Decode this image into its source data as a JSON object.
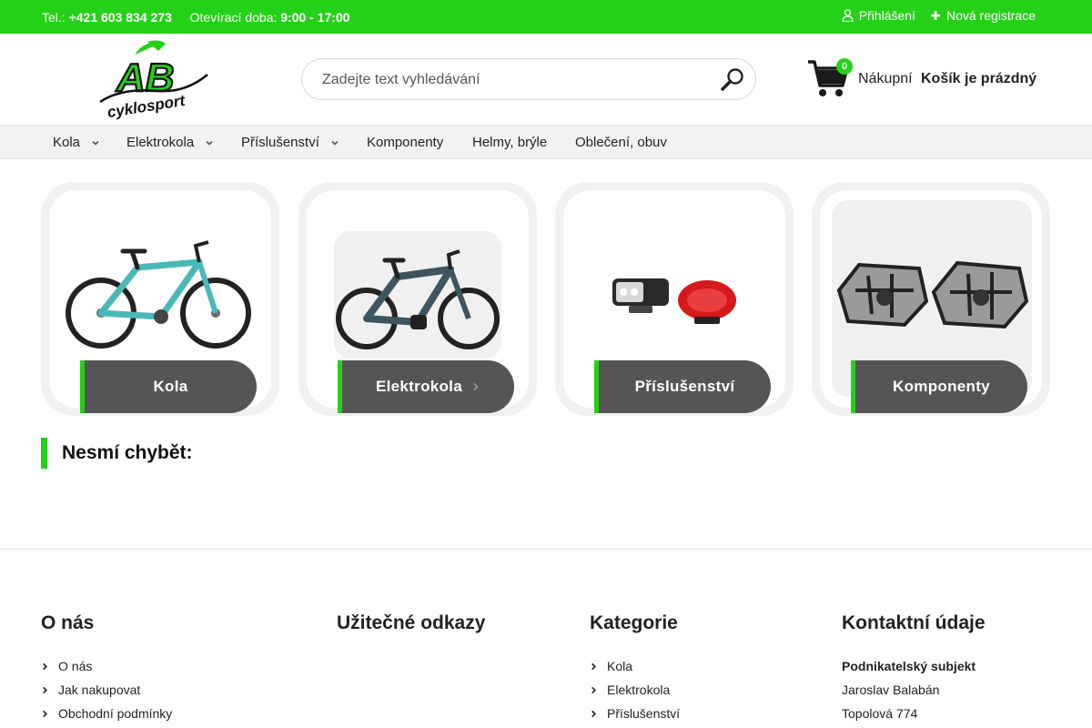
{
  "topbar": {
    "phone_label": "Tel.:",
    "phone": "+421 603 834 273",
    "hours_label": "Otevírací doba:",
    "hours": "9:00 - 17:00",
    "login": "Přihlášení",
    "register": "Nová registrace"
  },
  "logo": {
    "text_main": "AB",
    "text_sub": "cyklosport"
  },
  "search": {
    "placeholder": "Zadejte text vyhledávání"
  },
  "cart": {
    "count": "0",
    "label": "Nákupní",
    "status": "Košík je prázdný"
  },
  "nav": {
    "items": [
      {
        "label": "Kola"
      },
      {
        "label": "Elektrokola"
      },
      {
        "label": "Příslušenství"
      },
      {
        "label": "Komponenty"
      },
      {
        "label": "Helmy, brýle"
      },
      {
        "label": "Oblečení, obuv"
      }
    ]
  },
  "categories": [
    {
      "label": "Kola"
    },
    {
      "label": "Elektrokola"
    },
    {
      "label": "Příslušenství"
    },
    {
      "label": "Komponenty"
    }
  ],
  "section": {
    "title": "Nesmí chybět:"
  },
  "footer": {
    "about": {
      "title": "O nás",
      "links": [
        "O nás",
        "Jak nakupovat",
        "Obchodní podmínky"
      ]
    },
    "useful": {
      "title": "Užitečné odkazy"
    },
    "categories": {
      "title": "Kategorie",
      "links": [
        "Kola",
        "Elektrokola",
        "Příslušenství"
      ]
    },
    "contact": {
      "title": "Kontaktní údaje",
      "lines": [
        "Podnikatelský subjekt",
        "Jaroslav Balabán",
        "Topolová 774"
      ]
    }
  },
  "colors": {
    "accent": "#25d018",
    "label_bg": "#555555"
  }
}
